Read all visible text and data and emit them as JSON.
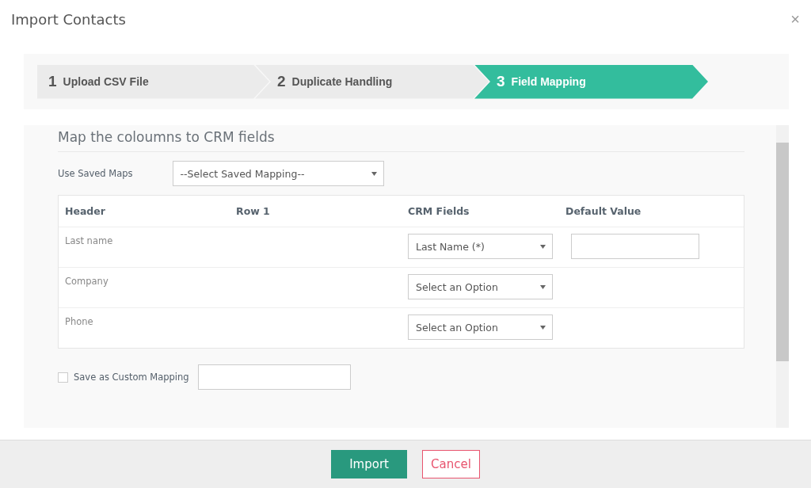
{
  "dialog": {
    "title": "Import Contacts",
    "close": "×"
  },
  "steps": [
    {
      "number": "1",
      "label": "Upload CSV File",
      "selected": false
    },
    {
      "number": "2",
      "label": "Duplicate Handling",
      "selected": false
    },
    {
      "number": "3",
      "label": "Field Mapping",
      "selected": true
    }
  ],
  "section_title": "Map the coloumns to CRM fields",
  "saved_maps": {
    "label": "Use Saved Maps",
    "value": "--Select Saved Mapping--"
  },
  "table": {
    "columns": [
      "Header",
      "Row 1",
      "CRM Fields",
      "Default Value"
    ],
    "rows": [
      {
        "header": "Last name",
        "crm_field": "Last Name  (*)",
        "has_default": true
      },
      {
        "header": "Company",
        "crm_field": "Select an Option",
        "has_default": false
      },
      {
        "header": "Phone",
        "crm_field": "Select an Option",
        "has_default": false
      }
    ]
  },
  "custom_mapping": {
    "label": "Save as Custom Mapping",
    "checked": false
  },
  "buttons": [
    {
      "label": "Import",
      "kind": "primary"
    },
    {
      "label": "Cancel",
      "kind": "secondary"
    }
  ]
}
